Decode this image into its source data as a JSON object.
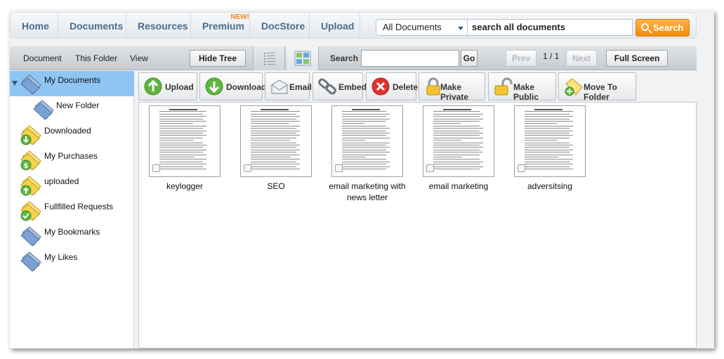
{
  "topnav": {
    "items": [
      {
        "label": "Home"
      },
      {
        "label": "Documents"
      },
      {
        "label": "Resources"
      },
      {
        "label": "Premium",
        "badge": "NEW!"
      },
      {
        "label": "DocStore"
      },
      {
        "label": "Upload"
      }
    ],
    "search_scope": "All Documents",
    "search_placeholder": "search all documents",
    "search_button": "Search"
  },
  "toolbar": {
    "menus": [
      "Document",
      "This Folder",
      "View"
    ],
    "hide_tree": "Hide Tree",
    "search_label": "Search",
    "go": "Go",
    "prev": "Prev",
    "page_indicator": "1 / 1",
    "next": "Next",
    "full_screen": "Full Screen"
  },
  "sidebar": {
    "items": [
      {
        "label": "My Documents",
        "icon": "folder-blue-icon"
      },
      {
        "label": "New Folder",
        "icon": "folder-blue-icon"
      },
      {
        "label": "Downloaded",
        "icon": "folder-download-icon"
      },
      {
        "label": "My Purchases",
        "icon": "folder-dollar-icon"
      },
      {
        "label": "uploaded",
        "icon": "folder-upload-icon"
      },
      {
        "label": "Fullfilled Requests",
        "icon": "folder-check-icon"
      },
      {
        "label": "My Bookmarks",
        "icon": "folder-blue-icon"
      },
      {
        "label": "My Likes",
        "icon": "folder-blue-icon"
      }
    ]
  },
  "actions": [
    {
      "label": "Upload",
      "icon": "upload-arrow-icon"
    },
    {
      "label": "Download",
      "icon": "download-arrow-icon"
    },
    {
      "label": "Email",
      "icon": "envelope-icon"
    },
    {
      "label": "Embed",
      "icon": "chain-link-icon"
    },
    {
      "label": "Delete",
      "icon": "delete-x-icon"
    },
    {
      "label": "Make Private",
      "icon": "lock-closed-icon"
    },
    {
      "label": "Make Public",
      "icon": "lock-open-icon"
    },
    {
      "label": "Move To Folder",
      "icon": "folder-add-icon"
    }
  ],
  "documents": [
    {
      "name": "keylogger"
    },
    {
      "name": "SEO"
    },
    {
      "name": "email marketing with news letter"
    },
    {
      "name": "email marketing"
    },
    {
      "name": "adversitsing"
    }
  ],
  "colors": {
    "nav_text": "#4a6d8c",
    "search_orange": "#f58a07",
    "badge_orange": "#f08a1c",
    "tree_selected": "#8ec5f2"
  }
}
